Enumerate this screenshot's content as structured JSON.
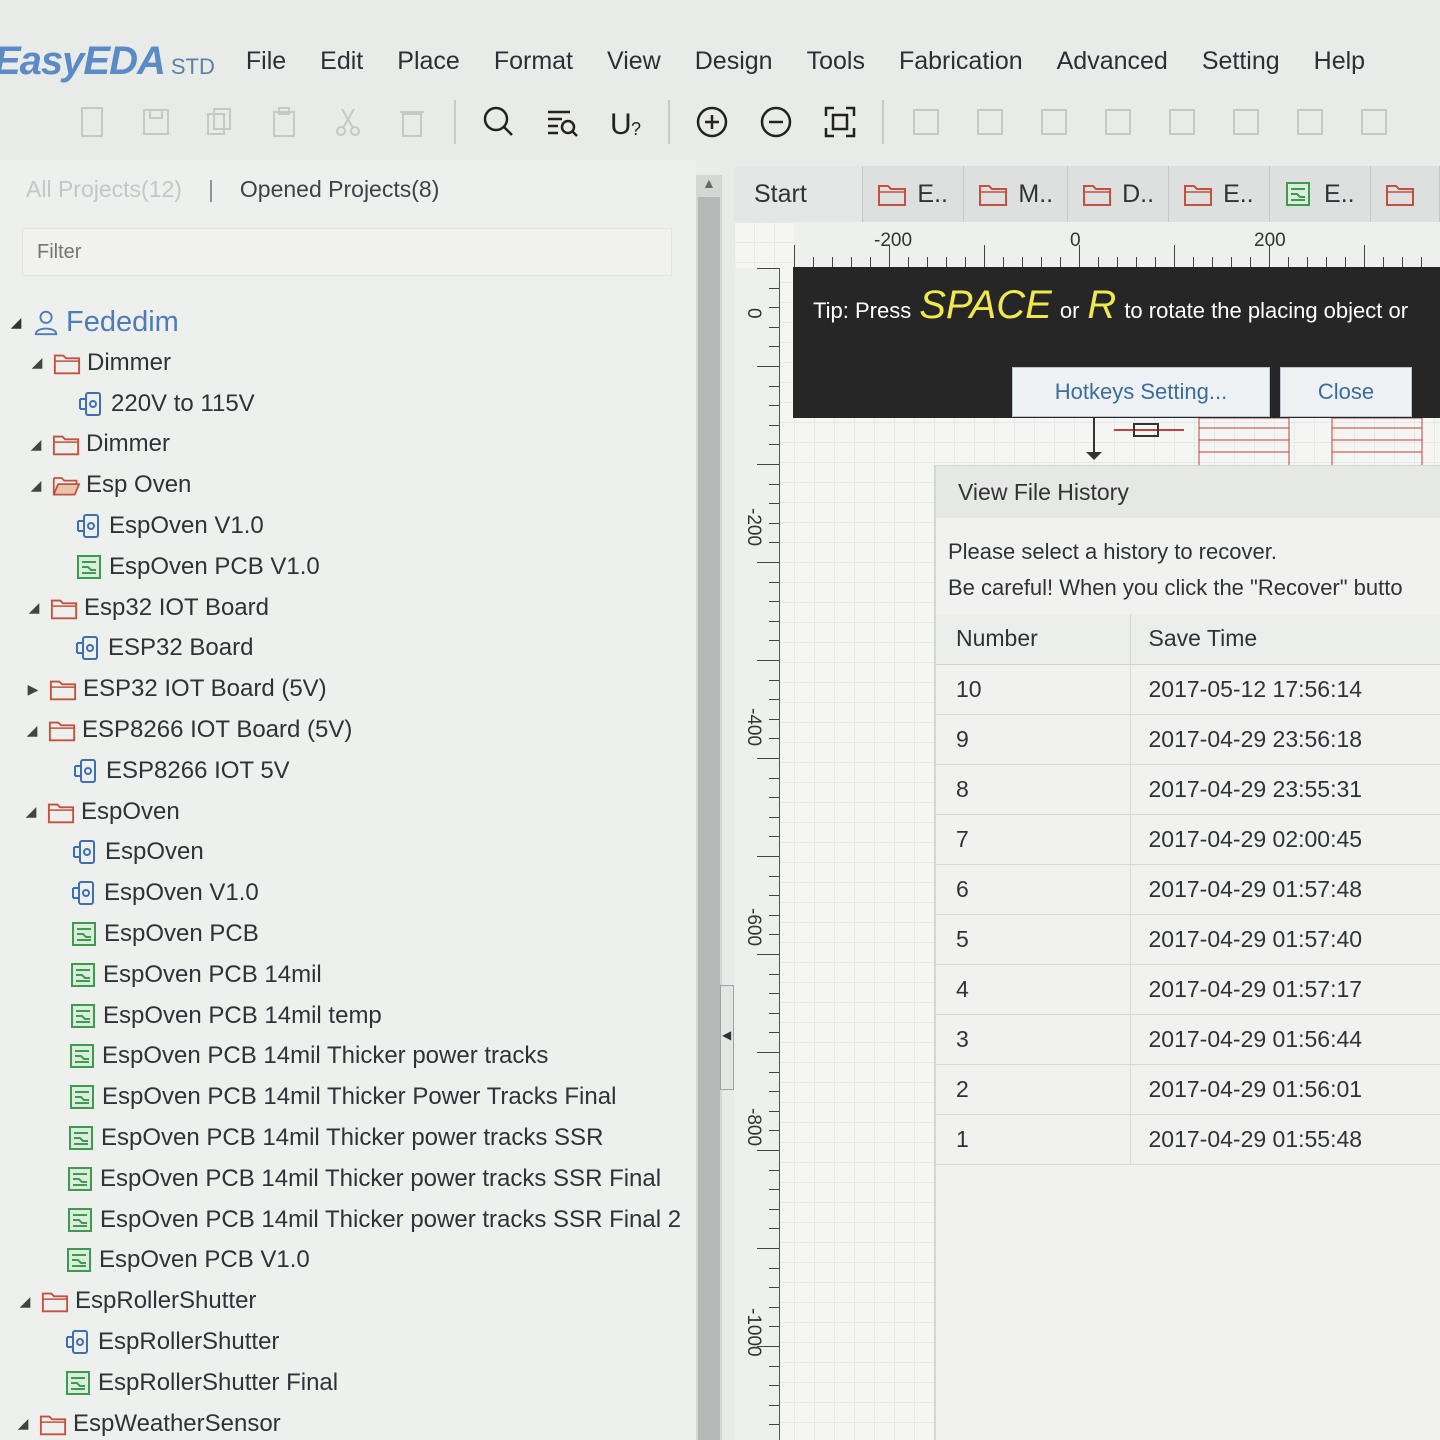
{
  "app": {
    "brand": "EasyEDA",
    "edition": "STD"
  },
  "menu": [
    "File",
    "Edit",
    "Place",
    "Format",
    "View",
    "Design",
    "Tools",
    "Fabrication",
    "Advanced",
    "Setting",
    "Help"
  ],
  "toolbar_icons": [
    "new-icon",
    "save-icon",
    "copy-icon",
    "paste-icon",
    "cut-icon",
    "delete-icon",
    "search-icon",
    "find-list-icon",
    "u-question-icon",
    "zoom-in-icon",
    "zoom-out-icon",
    "fit-view-icon"
  ],
  "left_panel": {
    "all_projects": "All Projects(12)",
    "separator": "|",
    "opened_projects": "Opened Projects(8)",
    "filter_placeholder": "Filter"
  },
  "tree": [
    {
      "label": "Fededim",
      "type": "user",
      "indent": 0
    },
    {
      "label": "Dimmer",
      "type": "folder",
      "indent": 1
    },
    {
      "label": "220V to 115V",
      "type": "schematic",
      "indent": 2
    },
    {
      "label": "Dimmer",
      "type": "folder",
      "indent": 1
    },
    {
      "label": "Esp Oven",
      "type": "folder-open",
      "indent": 1
    },
    {
      "label": "EspOven V1.0",
      "type": "schematic",
      "indent": 2
    },
    {
      "label": "EspOven PCB V1.0",
      "type": "pcb",
      "indent": 2
    },
    {
      "label": "Esp32 IOT Board",
      "type": "folder",
      "indent": 1
    },
    {
      "label": "ESP32 Board",
      "type": "schematic",
      "indent": 2
    },
    {
      "label": "ESP32 IOT Board (5V)",
      "type": "folder-collapsed",
      "indent": 1
    },
    {
      "label": "ESP8266 IOT Board (5V)",
      "type": "folder",
      "indent": 1
    },
    {
      "label": "ESP8266 IOT 5V",
      "type": "schematic",
      "indent": 2
    },
    {
      "label": "EspOven",
      "type": "folder",
      "indent": 1
    },
    {
      "label": "EspOven",
      "type": "schematic",
      "indent": 2
    },
    {
      "label": "EspOven V1.0",
      "type": "schematic",
      "indent": 2
    },
    {
      "label": "EspOven PCB",
      "type": "pcb",
      "indent": 2
    },
    {
      "label": "EspOven PCB 14mil",
      "type": "pcb",
      "indent": 2
    },
    {
      "label": "EspOven PCB 14mil temp",
      "type": "pcb",
      "indent": 2
    },
    {
      "label": "EspOven PCB 14mil Thicker power tracks",
      "type": "pcb",
      "indent": 2
    },
    {
      "label": "EspOven PCB 14mil Thicker Power Tracks Final",
      "type": "pcb",
      "indent": 2
    },
    {
      "label": "EspOven PCB 14mil Thicker power tracks SSR",
      "type": "pcb",
      "indent": 2
    },
    {
      "label": "EspOven PCB 14mil Thicker power tracks SSR Final",
      "type": "pcb",
      "indent": 2
    },
    {
      "label": "EspOven PCB 14mil Thicker power tracks SSR Final 2",
      "type": "pcb",
      "indent": 2
    },
    {
      "label": "EspOven PCB V1.0",
      "type": "pcb",
      "indent": 2
    },
    {
      "label": "EspRollerShutter",
      "type": "folder",
      "indent": 1
    },
    {
      "label": "EspRollerShutter",
      "type": "schematic",
      "indent": 2
    },
    {
      "label": "EspRollerShutter Final",
      "type": "pcb",
      "indent": 2
    },
    {
      "label": "EspWeatherSensor",
      "type": "folder",
      "indent": 1
    }
  ],
  "doc_tabs": [
    {
      "label": "Start",
      "type": "start"
    },
    {
      "label": "E..",
      "type": "folder"
    },
    {
      "label": "M..",
      "type": "folder"
    },
    {
      "label": "D..",
      "type": "folder"
    },
    {
      "label": "E..",
      "type": "folder"
    },
    {
      "label": "E..",
      "type": "pcb"
    }
  ],
  "ruler": {
    "top": [
      "-200",
      "0",
      "200"
    ],
    "left": [
      "0",
      "-200",
      "-400",
      "-600",
      "-800",
      "-1000"
    ]
  },
  "tip": {
    "prefix": "Tip: Press",
    "key1": "SPACE",
    "or": "or",
    "key2": "R",
    "suffix": "to rotate the placing object or",
    "hotkeys_button": "Hotkeys Setting...",
    "close_button": "Close"
  },
  "history": {
    "title": "View File History",
    "line1": "Please select a history to recover.",
    "line2": "Be careful! When you click the \"Recover\" butto",
    "col_number": "Number",
    "col_time": "Save Time",
    "rows": [
      {
        "number": "10",
        "time": "2017-05-12 17:56:14"
      },
      {
        "number": "9",
        "time": "2017-04-29 23:56:18"
      },
      {
        "number": "8",
        "time": "2017-04-29 23:55:31"
      },
      {
        "number": "7",
        "time": "2017-04-29 02:00:45"
      },
      {
        "number": "6",
        "time": "2017-04-29 01:57:48"
      },
      {
        "number": "5",
        "time": "2017-04-29 01:57:40"
      },
      {
        "number": "4",
        "time": "2017-04-29 01:57:17"
      },
      {
        "number": "3",
        "time": "2017-04-29 01:56:44"
      },
      {
        "number": "2",
        "time": "2017-04-29 01:56:01"
      },
      {
        "number": "1",
        "time": "2017-04-29 01:55:48"
      }
    ]
  },
  "colors": {
    "brand": "#5b8bc7",
    "tip_key": "#f0e84e",
    "pcb_icon": "#3e9a4e",
    "folder_icon": "#c4503f",
    "schematic_icon": "#3f6fb3"
  }
}
